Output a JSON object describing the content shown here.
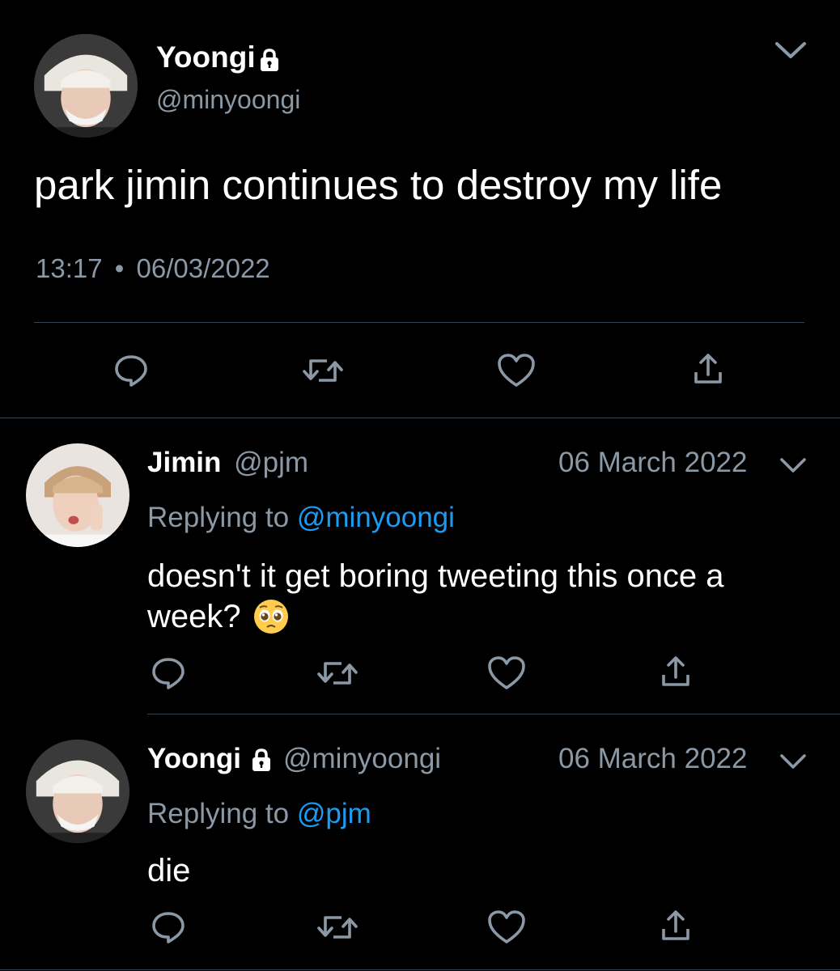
{
  "main_tweet": {
    "author_name": "Yoongi",
    "handle": "@minyoongi",
    "text": "park jimin continues to destroy my life",
    "time": "13:17",
    "separator": "•",
    "date": "06/03/2022",
    "locked": true
  },
  "replies": [
    {
      "author_name": "Jimin",
      "handle": "@pjm",
      "date": "06 March 2022",
      "replying_prefix": "Replying to",
      "replying_to": "@minyoongi",
      "text_line1": "doesn't it get boring tweeting this once a",
      "text_line2": "week?",
      "emoji": "🥺",
      "locked": false
    },
    {
      "author_name": "Yoongi",
      "handle": "@minyoongi",
      "date": "06 March 2022",
      "replying_prefix": "Replying to",
      "replying_to": "@pjm",
      "text_line1": "die",
      "locked": true
    }
  ],
  "icons": {
    "reply": "reply-icon",
    "retweet": "retweet-icon",
    "like": "heart-icon",
    "share": "share-icon",
    "menu": "chevron-down-icon",
    "lock": "lock-icon"
  },
  "colors": {
    "background": "#000000",
    "text": "#ffffff",
    "muted": "#8b98a5",
    "link": "#1d9bf0",
    "divider": "#38444d"
  }
}
